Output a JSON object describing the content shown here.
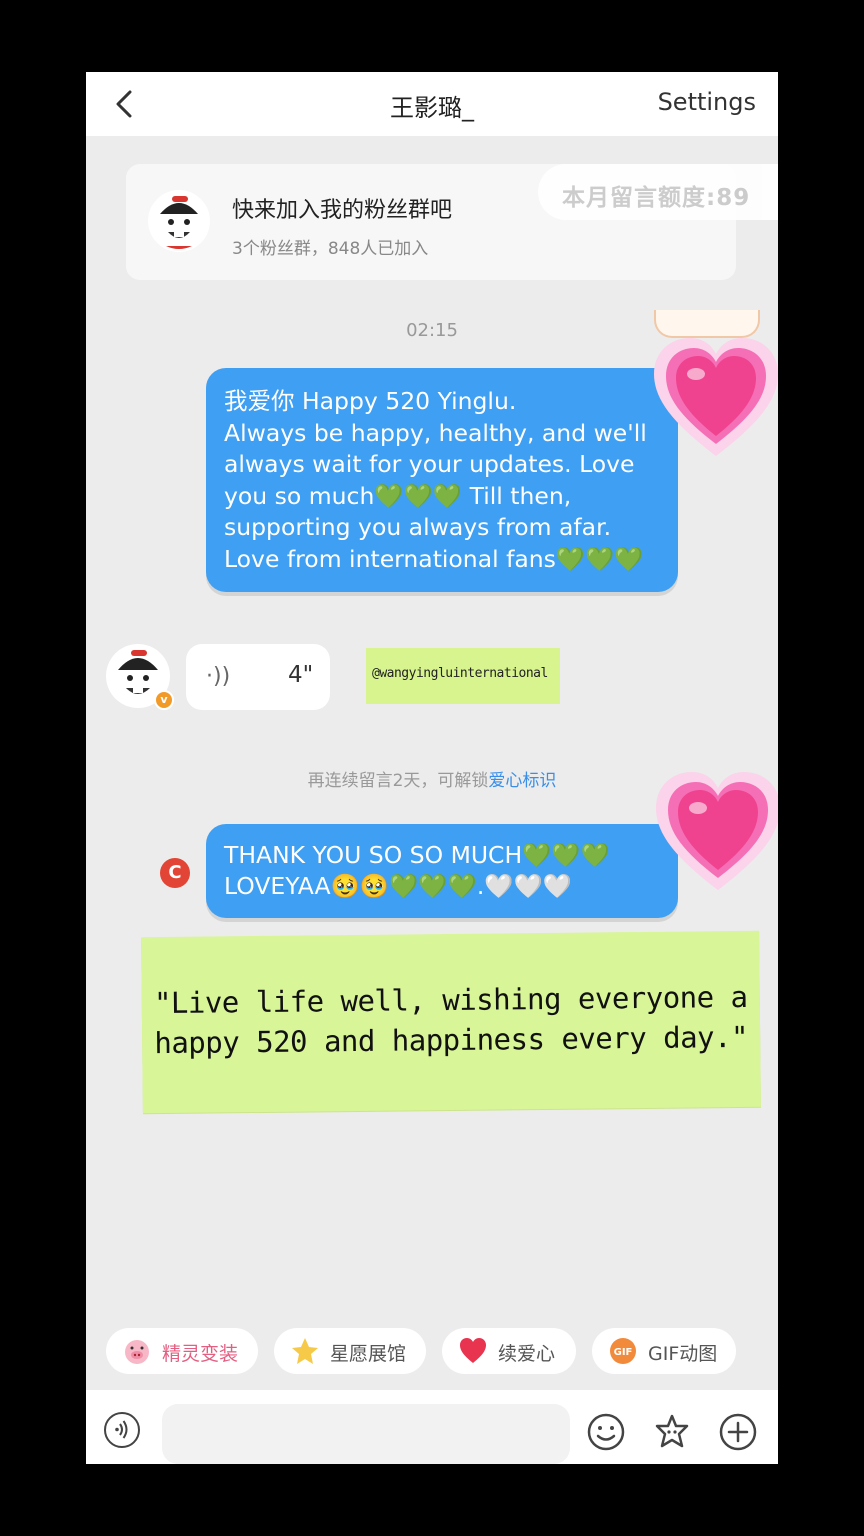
{
  "header": {
    "title": "王影璐_",
    "settings_label": "Settings",
    "back_icon": "chevron-left-icon"
  },
  "fan_group": {
    "title": "快来加入我的粉丝群吧",
    "subtitle": "3个粉丝群，848人已加入",
    "quota_label": "本月留言额度:89"
  },
  "conversation": {
    "timestamp": "02:15",
    "message1_lines": [
      "我爱你 Happy 520 Yinglu.",
      "Always be happy, healthy, and we'll",
      "always wait for your updates. Love",
      "you so much💚💚💚 Till then,",
      "supporting you always from afar.",
      "Love from international fans💚💚💚"
    ],
    "voice_reply": {
      "duration": "4\"",
      "icon": "sound-wave-icon"
    },
    "handle_tag": "@wangyingluinternational",
    "unlock_hint_prefix": "再连续留言2天，可解锁",
    "unlock_hint_highlight": "爱心标识",
    "message2_lines": [
      "THANK YOU SO SO MUCH💚💚💚",
      "LOVEYAA🥹🥹💚💚💚.🤍🤍🤍"
    ],
    "quote_note_lines": [
      "\"Live life well, wishing everyone a",
      "happy 520 and happiness every day.\""
    ]
  },
  "quick_actions": [
    {
      "label": "精灵变装",
      "icon": "pig-face-icon"
    },
    {
      "label": "星愿展馆",
      "icon": "star-icon"
    },
    {
      "label": "续爱心",
      "icon": "heart-icon"
    },
    {
      "label": "GIF动图",
      "icon": "gif-icon"
    }
  ],
  "input_bar": {
    "voice_icon": "voice-input-icon",
    "emoji_icon": "smiley-icon",
    "sticker_icon": "flower-icon",
    "add_icon": "plus-circle-icon"
  },
  "colors": {
    "bubble_blue": "#3f9ff2",
    "note_green": "#d8f598",
    "heart_pink": "#f0438f",
    "background": "#ececec"
  }
}
